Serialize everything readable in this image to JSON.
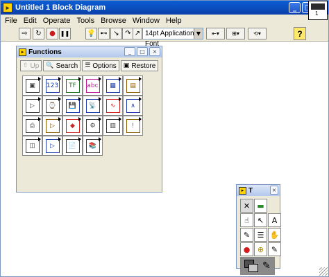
{
  "window": {
    "title": "Untitled 1 Block Diagram",
    "app_icon": "labview-icon",
    "buttons": [
      "_",
      "□",
      "×"
    ]
  },
  "menu": [
    "File",
    "Edit",
    "Operate",
    "Tools",
    "Browse",
    "Window",
    "Help"
  ],
  "toolbar": {
    "font_select": "14pt Application Font",
    "buttons": [
      {
        "name": "run-arrow-icon",
        "glyph": "⇨"
      },
      {
        "name": "run-continuously-icon",
        "glyph": "↻"
      },
      {
        "name": "abort-icon",
        "glyph": "●"
      },
      {
        "name": "pause-icon",
        "glyph": "❚❚"
      },
      {
        "name": "highlight-execution-icon",
        "glyph": "💡"
      },
      {
        "name": "retain-wire-values-icon",
        "glyph": "⊷"
      },
      {
        "name": "step-into-icon",
        "glyph": "↘"
      },
      {
        "name": "step-over-icon",
        "glyph": "↷"
      },
      {
        "name": "step-out-icon",
        "glyph": "↗"
      }
    ],
    "dropdowns": [
      "⇤▾",
      "⊞▾",
      "⟲▾"
    ],
    "help_glyph": "?",
    "vi_icon_number": "1"
  },
  "functions_palette": {
    "title": "Functions",
    "buttons": [
      {
        "label": "Up",
        "icon": "up-arrow-icon",
        "glyph": "⇧"
      },
      {
        "label": "Search",
        "icon": "search-icon",
        "glyph": "🔍"
      },
      {
        "label": "Options",
        "icon": "options-icon",
        "glyph": "☰"
      },
      {
        "label": "Restore",
        "icon": "restore-icon",
        "glyph": "▣"
      }
    ],
    "cells": [
      {
        "name": "structures-icon",
        "glyph": "▣",
        "color": "#3a3a3a"
      },
      {
        "name": "numeric-icon",
        "glyph": "123",
        "color": "#1c3aa8"
      },
      {
        "name": "boolean-icon",
        "glyph": "TF",
        "color": "#1c6e22"
      },
      {
        "name": "string-icon",
        "glyph": "abc",
        "color": "#c2179a"
      },
      {
        "name": "array-icon",
        "glyph": "▦",
        "color": "#1c3aa8"
      },
      {
        "name": "cluster-icon",
        "glyph": "▤",
        "color": "#8a5a00"
      },
      {
        "name": "comparison-icon",
        "glyph": "▷",
        "color": "#3a3a3a"
      },
      {
        "name": "time-dialog-icon",
        "glyph": "⌚",
        "color": "#3a3a3a"
      },
      {
        "name": "file-io-icon",
        "glyph": "💾",
        "color": "#1c3aa8"
      },
      {
        "name": "communication-icon",
        "glyph": "📡",
        "color": "#1c3aa8"
      },
      {
        "name": "waveform-icon",
        "glyph": "∿",
        "color": "#c22"
      },
      {
        "name": "analyze-icon",
        "glyph": "∧",
        "color": "#1c3aa8"
      },
      {
        "name": "instrument-io-icon",
        "glyph": "⎙",
        "color": "#3a3a3a"
      },
      {
        "name": "mathematics-icon",
        "glyph": "▷",
        "color": "#8a5a00"
      },
      {
        "name": "signal-processing-icon",
        "glyph": "◆",
        "color": "#c22"
      },
      {
        "name": "data-acquisition-icon",
        "glyph": "⚙",
        "color": "#3a3a3a"
      },
      {
        "name": "graphics-sound-icon",
        "glyph": "▥",
        "color": "#3a3a3a"
      },
      {
        "name": "application-control-icon",
        "glyph": "!",
        "color": "#8a5a00"
      },
      {
        "name": "report-generation-icon",
        "glyph": "◫",
        "color": "#3a3a3a"
      },
      {
        "name": "advanced-icon",
        "glyph": "▷",
        "color": "#1c3aa8"
      },
      {
        "name": "select-vi-icon",
        "glyph": "📄",
        "color": "#3a3a3a"
      },
      {
        "name": "libraries-icon",
        "glyph": "📚",
        "color": "#3a3a3a"
      }
    ]
  },
  "tools_palette": {
    "title": "T",
    "tools": [
      {
        "name": "automatic-tool-icon",
        "glyph": "✕"
      },
      {
        "name": "led-indicator-icon",
        "glyph": "▬"
      },
      {
        "name": "spacer-icon",
        "glyph": ""
      },
      {
        "name": "operate-value-icon",
        "glyph": "☝"
      },
      {
        "name": "position-select-icon",
        "glyph": "↖"
      },
      {
        "name": "edit-text-icon",
        "glyph": "A"
      },
      {
        "name": "connect-wire-icon",
        "glyph": "✎"
      },
      {
        "name": "object-shortcut-menu-icon",
        "glyph": "☰"
      },
      {
        "name": "scroll-window-icon",
        "glyph": "✋"
      },
      {
        "name": "set-breakpoint-icon",
        "glyph": "●"
      },
      {
        "name": "probe-data-icon",
        "glyph": "⊕"
      },
      {
        "name": "get-color-icon",
        "glyph": "✎"
      }
    ]
  }
}
